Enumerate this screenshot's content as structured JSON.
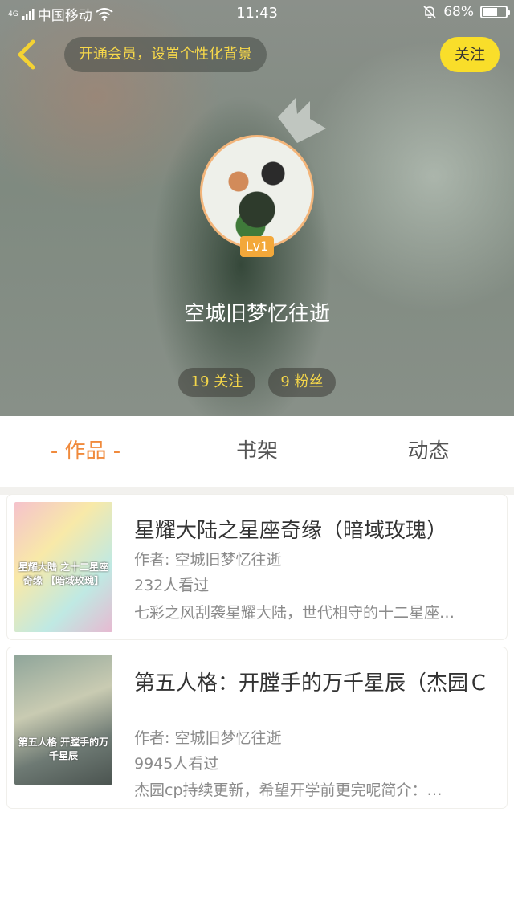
{
  "status_bar": {
    "network": "4G",
    "carrier": "中国移动",
    "time": "11:43",
    "battery": "68%",
    "battery_level": 0.68
  },
  "header": {
    "vip_promo": "开通会员，设置个性化背景",
    "follow_label": "关注",
    "level_badge": "Lv1",
    "username": "空城旧梦忆往逝",
    "following": "19 关注",
    "followers": "9 粉丝"
  },
  "tabs": [
    {
      "label": "- 作品 -",
      "active": true
    },
    {
      "label": "书架",
      "active": false
    },
    {
      "label": "动态",
      "active": false
    }
  ],
  "works": [
    {
      "title": "星耀大陆之星座奇缘（暗域玫瑰）",
      "author": "作者: 空城旧梦忆往逝",
      "views": "232人看过",
      "summary": "七彩之风刮袭星耀大陆，世代相守的十二星座…",
      "cover_text": "星耀大陆 之十二星座奇缘 【暗域玫瑰】"
    },
    {
      "title": "第五人格：开膛手的万千星辰（杰园Ｃ",
      "author": "作者: 空城旧梦忆往逝",
      "views": "9945人看过",
      "summary": "杰园cp持续更新，希望开学前更完呢简介：…",
      "cover_text": "第五人格 开膛手的万千星辰"
    }
  ],
  "colors": {
    "accent_orange": "#f08a3c",
    "follow_yellow": "#f9de2a",
    "promo_text": "#f7d84a"
  }
}
